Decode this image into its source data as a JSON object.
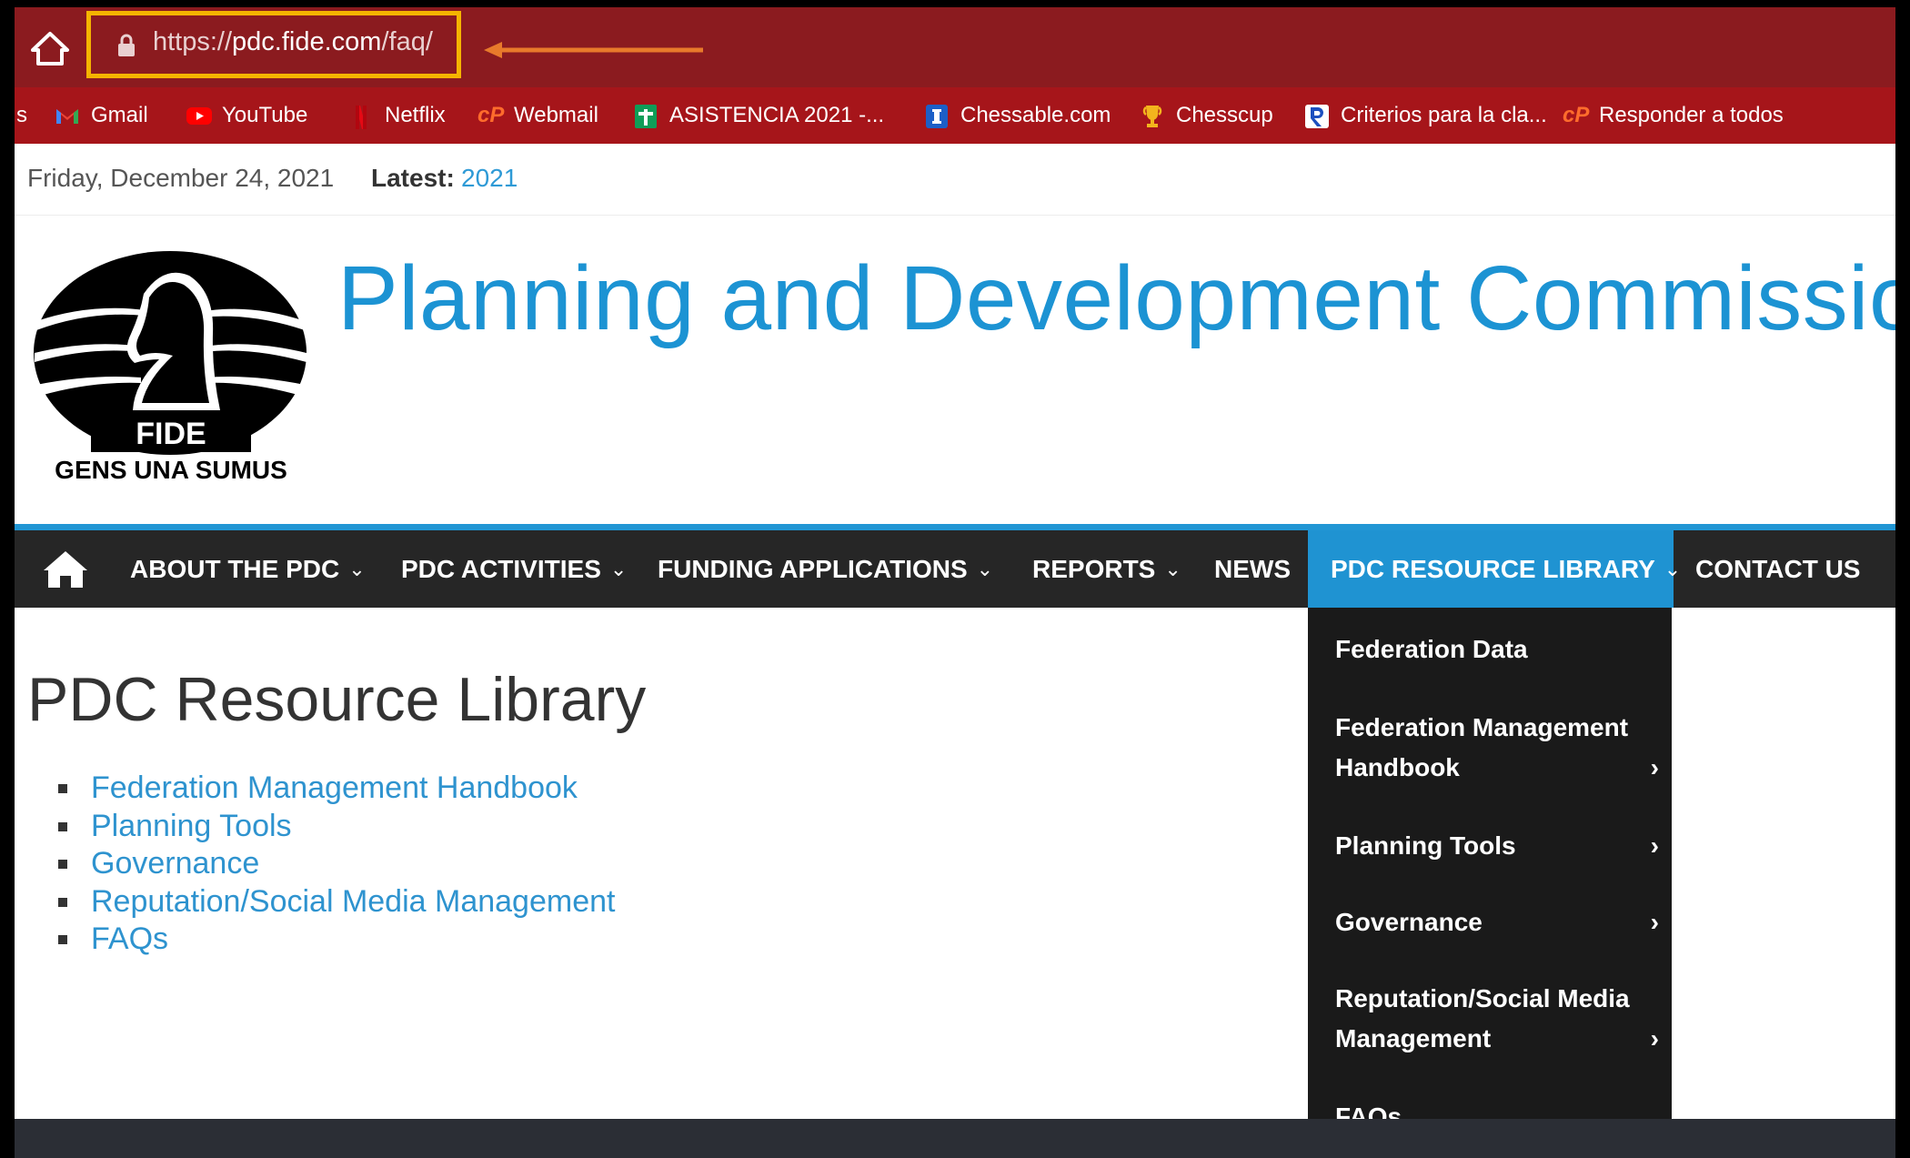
{
  "browser": {
    "url_prefix": "https://",
    "url_domain": "pdc.fide.com",
    "url_path": "/faq/",
    "bookmarks": [
      {
        "label": "s",
        "icon": "truncated"
      },
      {
        "label": "Gmail",
        "icon": "gmail-icon"
      },
      {
        "label": "YouTube",
        "icon": "youtube-icon"
      },
      {
        "label": "Netflix",
        "icon": "netflix-icon"
      },
      {
        "label": "Webmail",
        "icon": "cpanel-icon"
      },
      {
        "label": "ASISTENCIA 2021 -...",
        "icon": "sheets-icon"
      },
      {
        "label": "Chessable.com",
        "icon": "chessable-icon"
      },
      {
        "label": "Chesscup",
        "icon": "trophy-icon"
      },
      {
        "label": "Criterios para la cla...",
        "icon": "r-icon"
      },
      {
        "label": "Responder a todos",
        "icon": "cpanel-icon"
      }
    ]
  },
  "topbar": {
    "date": "Friday, December 24, 2021",
    "latest_label": "Latest:",
    "latest_value": "2021"
  },
  "header": {
    "title": "Planning and Development Commission",
    "logo_text_1": "FIDE",
    "logo_text_2": "GENS UNA SUMUS"
  },
  "nav": {
    "items": [
      {
        "label": "ABOUT THE PDC",
        "dropdown": true
      },
      {
        "label": "PDC ACTIVITIES",
        "dropdown": true
      },
      {
        "label": "FUNDING APPLICATIONS",
        "dropdown": true
      },
      {
        "label": "REPORTS",
        "dropdown": true
      },
      {
        "label": "NEWS",
        "dropdown": false
      },
      {
        "label": "PDC RESOURCE LIBRARY",
        "dropdown": true,
        "active": true
      },
      {
        "label": "CONTACT US",
        "dropdown": false
      }
    ],
    "chevron": "⌄"
  },
  "dropdown": {
    "items": [
      {
        "line1": "Federation Data",
        "line2": "",
        "submenu": false
      },
      {
        "line1": "Federation Management",
        "line2": "Handbook",
        "submenu": true
      },
      {
        "line1": "Planning Tools",
        "line2": "",
        "submenu": true
      },
      {
        "line1": "Governance",
        "line2": "",
        "submenu": true
      },
      {
        "line1": "Reputation/Social Media",
        "line2": "Management",
        "submenu": true
      },
      {
        "line1": "FAQs",
        "line2": "",
        "submenu": false
      }
    ],
    "arrow": "›"
  },
  "main": {
    "title": "PDC Resource Library",
    "links": [
      "Federation Management Handbook",
      "Planning Tools",
      "Governance",
      "Reputation/Social Media Management",
      "FAQs"
    ]
  },
  "colors": {
    "address_bar": "#8b1b1f",
    "bookmarks_bar": "#a6151a",
    "highlight_box": "#f5b400",
    "arrow": "#e87a2b",
    "accent": "#1f93d2",
    "nav_bg": "#262626",
    "dropdown_bg": "#1a1a1a"
  }
}
